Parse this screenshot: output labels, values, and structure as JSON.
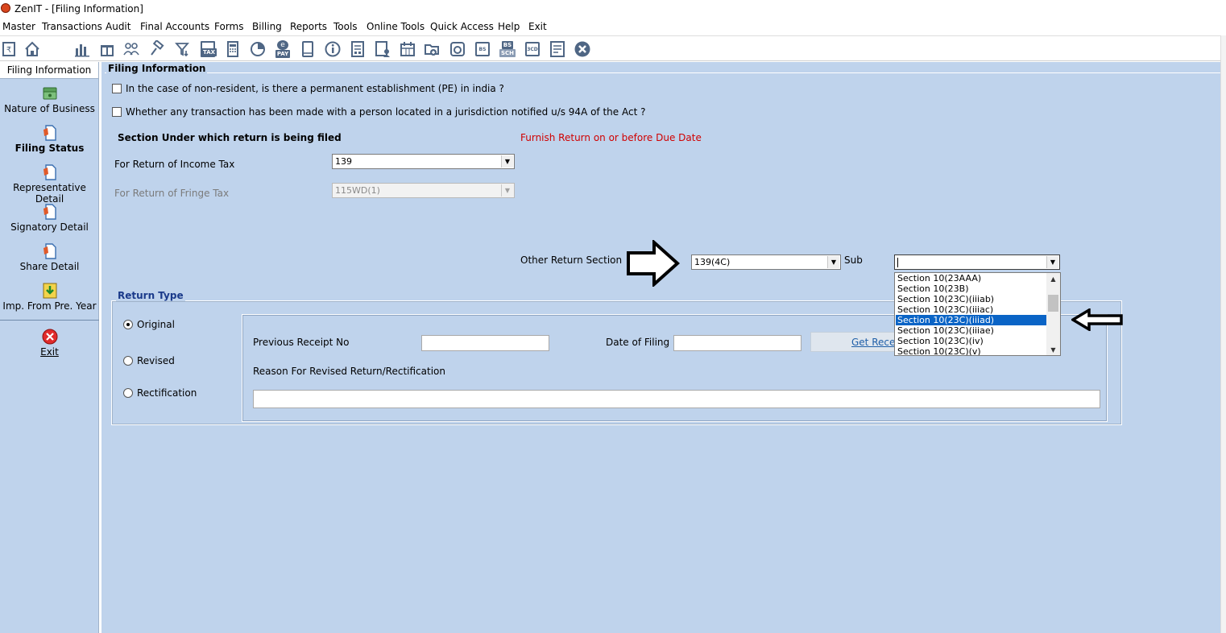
{
  "window": {
    "title": "ZenIT - [Filing Information]"
  },
  "menu": [
    "Master",
    "Transactions",
    "Audit",
    "Final Accounts",
    "Forms",
    "Billing",
    "Reports",
    "Tools",
    "Online Tools",
    "Quick Access",
    "Help",
    "Exit"
  ],
  "toolbar": {
    "icons": [
      "rupee-doc-icon",
      "home-icon",
      "bar-chart-icon",
      "gift-icon",
      "users-icon",
      "hammer-icon",
      "filter-icon",
      "tax-icon",
      "calculator-icon",
      "pie-chart-icon",
      "e-pay-icon",
      "book-icon",
      "info-icon",
      "report-icon",
      "user-doc-icon",
      "calendar-icon",
      "add-folder-icon",
      "refresh-icon",
      "bs-icon",
      "bs-sch-icon",
      "3cd-icon",
      "form-icon",
      "close-icon"
    ],
    "tax_text": "TAX",
    "pay_text": "PAY",
    "bs_text": "BS",
    "sch_text": "SCH",
    "cd_text": "3CD"
  },
  "sidebar": {
    "header": "Filing Information",
    "items": [
      {
        "label": "Nature of Business",
        "icon": "money-icon"
      },
      {
        "label": "Filing Status",
        "icon": "document-icon"
      },
      {
        "label": "Representative Detail",
        "icon": "document-icon"
      },
      {
        "label": "Signatory Detail",
        "icon": "document-icon"
      },
      {
        "label": "Share Detail",
        "icon": "document-icon"
      },
      {
        "label": "Imp. From Pre. Year",
        "icon": "import-icon"
      }
    ],
    "exit_label": "Exit"
  },
  "form": {
    "group_title": "Filing Information",
    "pe_question": "In the case of non-resident, is there a permanent establishment (PE) in india ?",
    "jurisdiction_question": "Whether any transaction has been made with a person located in a jurisdiction notified u/s 94A of the Act ?",
    "section_heading": "Section Under which return is being filed",
    "due_date_notice": "Furnish Return on or before Due Date",
    "income_tax_label": "For Return of Income Tax",
    "income_tax_value": "139",
    "fringe_tax_label": "For Return of Fringe Tax",
    "fringe_tax_value": "115WD(1)",
    "other_section_label": "Other Return Section",
    "other_section_value": "139(4C)",
    "sub_label": "Sub",
    "sub_value": "",
    "sub_options": [
      "Section 10(23AAA)",
      "Section 10(23B)",
      "Section 10(23C)(iiiab)",
      "Section 10(23C)(iiiac)",
      "Section 10(23C)(iiiad)",
      "Section 10(23C)(iiiae)",
      "Section 10(23C)(iv)",
      "Section 10(23C)(v)"
    ],
    "sub_selected": "Section 10(23C)(iiiad)"
  },
  "return_type": {
    "title": "Return Type",
    "options": [
      "Original",
      "Revised",
      "Rectification"
    ],
    "selected": "Original",
    "prev_receipt_label": "Previous Receipt No",
    "prev_receipt_value": "",
    "date_filing_label": "Date of Filing",
    "date_filing_value": "",
    "get_receipt_label": "Get Rece",
    "reason_label": "Reason For Revised Return/Rectification",
    "reason_value": ""
  },
  "colors": {
    "panel_bg": "#bfd3ec",
    "selected_option": "#0a64c6",
    "notice_red": "#d00000",
    "section_title_blue": "#1a3a8a"
  }
}
